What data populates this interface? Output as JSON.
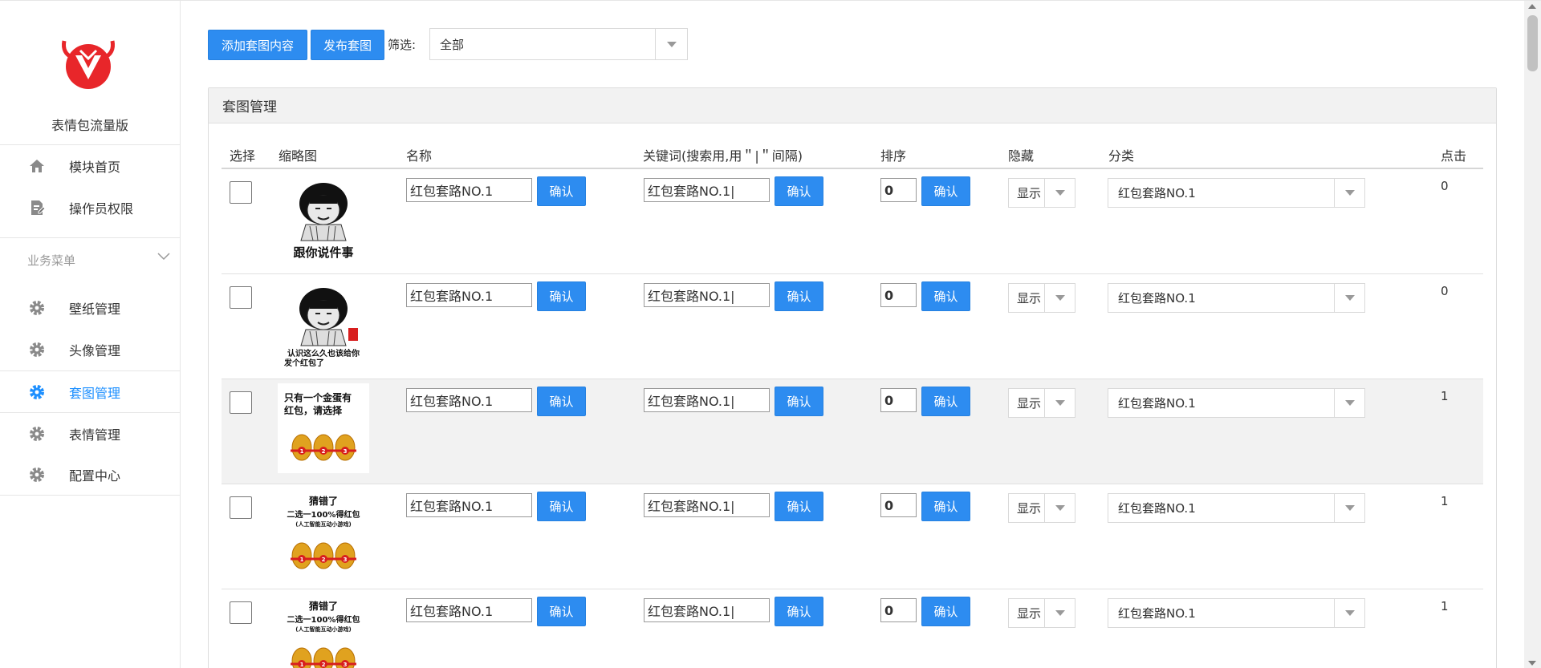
{
  "brand": {
    "name": "表情包流量版"
  },
  "sidebar": {
    "top_items": [
      {
        "label": "模块首页",
        "icon": "home-icon"
      },
      {
        "label": "操作员权限",
        "icon": "document-edit-icon"
      }
    ],
    "group_label": "业务菜单",
    "items": [
      {
        "label": "壁纸管理",
        "icon": "gear-icon",
        "active": false
      },
      {
        "label": "头像管理",
        "icon": "gear-icon",
        "active": false
      },
      {
        "label": "套图管理",
        "icon": "gear-icon",
        "active": true
      },
      {
        "label": "表情管理",
        "icon": "gear-icon",
        "active": false
      },
      {
        "label": "配置中心",
        "icon": "gear-icon",
        "active": false
      }
    ]
  },
  "toolbar": {
    "add_label": "添加套图内容",
    "publish_label": "发布套图",
    "filter_label": "筛选:",
    "filter_value": "全部"
  },
  "panel": {
    "title": "套图管理",
    "columns": {
      "select": "选择",
      "thumb": "缩略图",
      "name": "名称",
      "keywords": "关键词(搜索用,用＂|＂间隔)",
      "order": "排序",
      "hidden": "隐藏",
      "category": "分类",
      "clicks": "点击"
    },
    "confirm_label": "确认",
    "rows": [
      {
        "thumb_caption": [
          "跟你说件事"
        ],
        "name": "红包套路NO.1",
        "keywords": "红包套路NO.1|",
        "order": "0",
        "hidden": "显示",
        "category": "红包套路NO.1",
        "clicks": "0"
      },
      {
        "thumb_caption": [
          "认识这么久也该给你",
          "发个红包了"
        ],
        "name": "红包套路NO.1",
        "keywords": "红包套路NO.1|",
        "order": "0",
        "hidden": "显示",
        "category": "红包套路NO.1",
        "clicks": "0"
      },
      {
        "thumb_caption": [
          "只有一个金蛋有",
          "红包，请选择"
        ],
        "name": "红包套路NO.1",
        "keywords": "红包套路NO.1|",
        "order": "0",
        "hidden": "显示",
        "category": "红包套路NO.1",
        "clicks": "1"
      },
      {
        "thumb_caption": [
          "猜错了",
          "二选一100%得红包",
          "(人工智能互动小游戏)"
        ],
        "name": "红包套路NO.1",
        "keywords": "红包套路NO.1|",
        "order": "0",
        "hidden": "显示",
        "category": "红包套路NO.1",
        "clicks": "1"
      },
      {
        "thumb_caption": [
          "猜错了",
          "二选一100%得红包",
          "(人工智能互动小游戏)"
        ],
        "name": "红包套路NO.1",
        "keywords": "红包套路NO.1|",
        "order": "0",
        "hidden": "显示",
        "category": "红包套路NO.1",
        "clicks": "1"
      }
    ]
  },
  "colors": {
    "accent": "#2d8cf0",
    "logo_red": "#e8262a",
    "active_nav": "#1e90ff"
  }
}
